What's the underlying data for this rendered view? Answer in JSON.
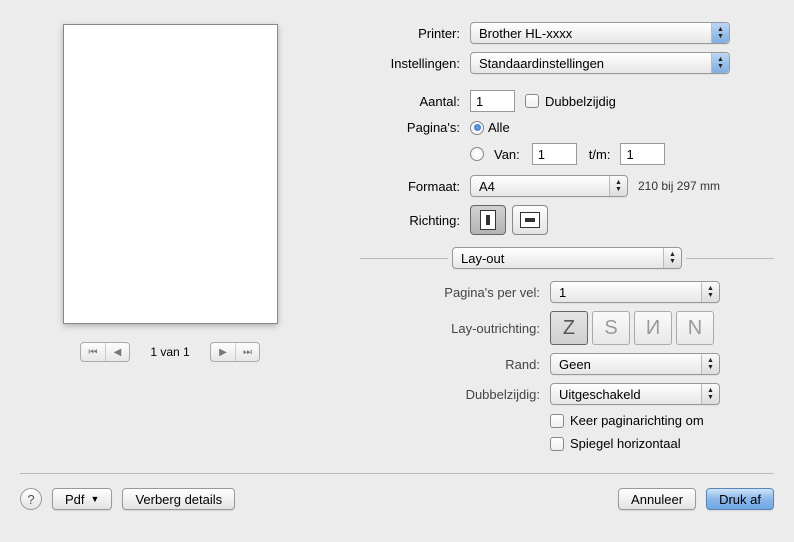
{
  "labels": {
    "printer": "Printer:",
    "settings": "Instellingen:",
    "copies": "Aantal:",
    "duplex_check": "Dubbelzijdig",
    "pages": "Pagina's:",
    "all": "Alle",
    "from": "Van:",
    "to": "t/m:",
    "format": "Formaat:",
    "orientation": "Richting:",
    "layout": "Lay-out",
    "pages_per_sheet": "Pagina's per vel:",
    "layout_direction": "Lay-outrichting:",
    "border": "Rand:",
    "two_sided": "Dubbelzijdig:",
    "flip_pages": "Keer paginarichting om",
    "mirror": "Spiegel horizontaal",
    "pdf": "Pdf",
    "hide_details": "Verberg details",
    "cancel": "Annuleer",
    "print": "Druk af"
  },
  "values": {
    "printer": "Brother HL-xxxx",
    "settings": "Standaardinstellingen",
    "copies": "1",
    "pages_option": "all",
    "from": "1",
    "to": "1",
    "format": "A4",
    "format_note": "210 bij 297 mm",
    "pages_per_sheet": "1",
    "border": "Geen",
    "two_sided": "Uitgeschakeld"
  },
  "preview": {
    "page_indicator": "1 van 1"
  }
}
